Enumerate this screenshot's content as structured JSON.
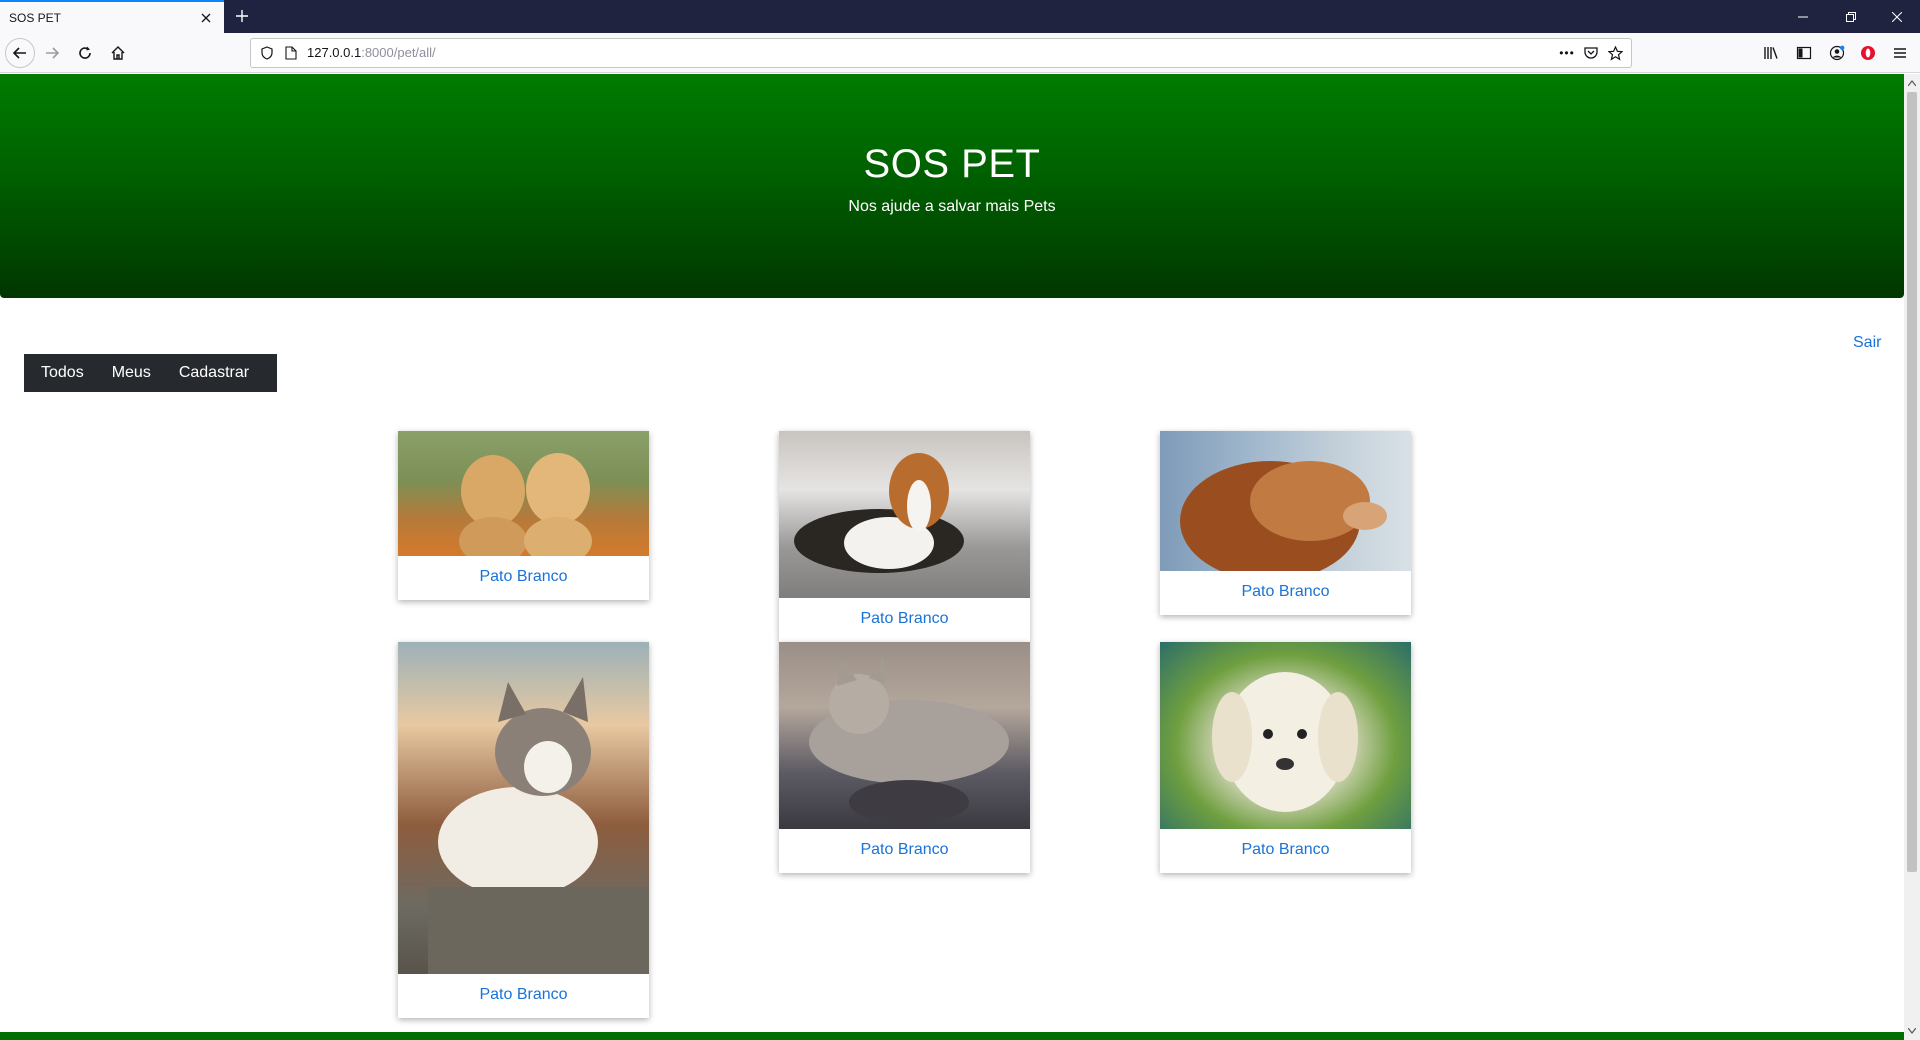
{
  "browser": {
    "tab_title": "SOS PET",
    "url_host": "127.0.0.1",
    "url_path": ":8000/pet/all/",
    "url_more": "•••"
  },
  "page": {
    "title": "SOS PET",
    "subtitle": "Nos ajude a salvar mais Pets",
    "logout": "Sair",
    "menu": [
      "Todos",
      "Meus",
      "Cadastrar"
    ],
    "cards": [
      {
        "city": "Pato Branco",
        "photo": "two-golden-puppies-photo"
      },
      {
        "city": "Pato Branco",
        "photo": "beagle-lying-on-floor-photo"
      },
      {
        "city": "Pato Branco",
        "photo": "brown-dog-profile-photo"
      },
      {
        "city": "Pato Branco",
        "photo": "tabby-cat-on-rock-photo"
      },
      {
        "city": "Pato Branco",
        "photo": "cat-with-kittens-photo"
      },
      {
        "city": "Pato Branco",
        "photo": "white-puppy-photo"
      }
    ]
  },
  "colors": {
    "hero_top": "#007c00",
    "hero_bottom": "#003600",
    "link": "#1a73d6",
    "menu_bg": "#262a2e",
    "tab_accent": "#0a84ff"
  }
}
